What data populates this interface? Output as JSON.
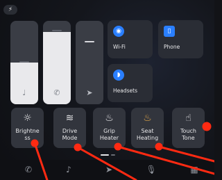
{
  "status": {
    "top_indicator_icon": "bolt-icon"
  },
  "sliders": [
    {
      "name": "media-volume",
      "icon": "music-note-icon",
      "glyph": "♩",
      "level_percent": 50
    },
    {
      "name": "call-volume",
      "icon": "phone-icon",
      "glyph": "✆",
      "level_percent": 87
    },
    {
      "name": "navigation-volume",
      "icon": "navigation-arrow-icon",
      "glyph": "➤",
      "level_percent": 0
    }
  ],
  "quick_tiles": [
    {
      "label": "Wi-Fi",
      "icon": "wifi-icon",
      "glyph": "◉"
    },
    {
      "label": "Phone",
      "icon": "phone-device-icon",
      "glyph": "▯"
    },
    {
      "label": "Headsets",
      "icon": "headset-icon",
      "glyph": "◗"
    }
  ],
  "function_tiles": [
    {
      "label": "Brightne ss",
      "icon": "sun-icon",
      "glyph": "☼"
    },
    {
      "label": "Drive Mode",
      "icon": "drive-mode-icon",
      "glyph": "≋"
    },
    {
      "label": "Grip Heater",
      "icon": "grip-heater-icon",
      "glyph": "♨"
    },
    {
      "label": "Seat Heating",
      "icon": "seat-heating-icon",
      "glyph": "♨"
    },
    {
      "label": "Touch Tone",
      "icon": "touch-tone-icon",
      "glyph": "☝"
    }
  ],
  "page_indicator": {
    "pages": 2,
    "active": 0
  },
  "dock": [
    {
      "name": "phone",
      "icon": "phone-icon",
      "glyph": "✆"
    },
    {
      "name": "music",
      "icon": "music-note-icon",
      "glyph": "♪"
    },
    {
      "name": "navigation",
      "icon": "navigation-icon",
      "glyph": "➤"
    },
    {
      "name": "voice",
      "icon": "microphone-icon",
      "glyph": "🎙"
    },
    {
      "name": "apps",
      "icon": "app-grid-icon",
      "glyph": "▦"
    }
  ],
  "colors": {
    "accent": "#2a7fff",
    "annotation": "#ff2a12",
    "seat_heating_icon": "#e4a84a"
  }
}
